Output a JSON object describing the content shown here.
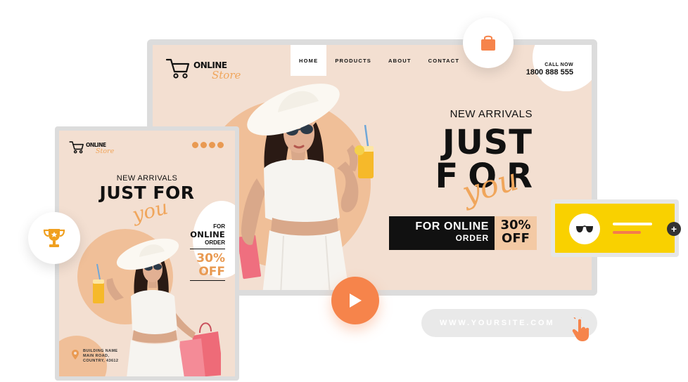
{
  "desktop": {
    "logo": {
      "word1": "ONLINE",
      "word2": "Store"
    },
    "nav": [
      "HOME",
      "PRODUCTS",
      "ABOUT",
      "CONTACT"
    ],
    "call": {
      "label": "CALL NOW",
      "number": "1800 888 555"
    },
    "headline": {
      "kicker": "NEW ARRIVALS",
      "line1": "JUST",
      "line2": "FOR",
      "script": "you"
    },
    "promo": {
      "line1": "FOR ONLINE",
      "line2": "ORDER",
      "pct": "30%",
      "off": "OFF"
    }
  },
  "mobile": {
    "logo": {
      "word1": "ONLINE",
      "word2": "Store"
    },
    "kicker": "NEW ARRIVALS",
    "title": "JUST FOR",
    "script": "you",
    "offer": {
      "for": "FOR",
      "online": "ONLINE",
      "order": "ORDER",
      "pct": "30%",
      "off": "OFF"
    },
    "address": [
      "BUILDING NAME",
      "MAIN ROAD,",
      "COUNTRY, 43612"
    ]
  },
  "url": "WWW.YOURSITE.COM",
  "colors": {
    "accent": "#f6844b",
    "peach": "#f3dfd1",
    "yellow": "#f9d100",
    "script": "#f0a65c"
  },
  "icons": [
    "shopping-bag-icon",
    "trophy-icon",
    "play-icon",
    "sunglasses-icon",
    "plus-icon",
    "pointer-hand-icon",
    "location-pin-icon",
    "cart-icon"
  ]
}
